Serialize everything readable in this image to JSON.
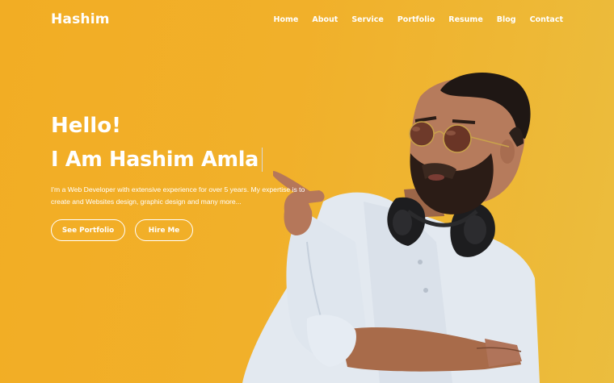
{
  "header": {
    "logo": "Hashim",
    "nav": [
      "Home",
      "About",
      "Service",
      "Portfolio",
      "Resume",
      "Blog",
      "Contact"
    ]
  },
  "hero": {
    "greeting": "Hello!",
    "headline": "I Am Hashim Amla",
    "description": "I'm a Web Developer with extensive experience for over 5 years. My expertise is to create and Websites design, graphic design and many more...",
    "buttons": {
      "portfolio": "See Portfolio",
      "hire": "Hire Me"
    }
  },
  "colors": {
    "background": "#f2ad24",
    "text": "#ffffff"
  }
}
